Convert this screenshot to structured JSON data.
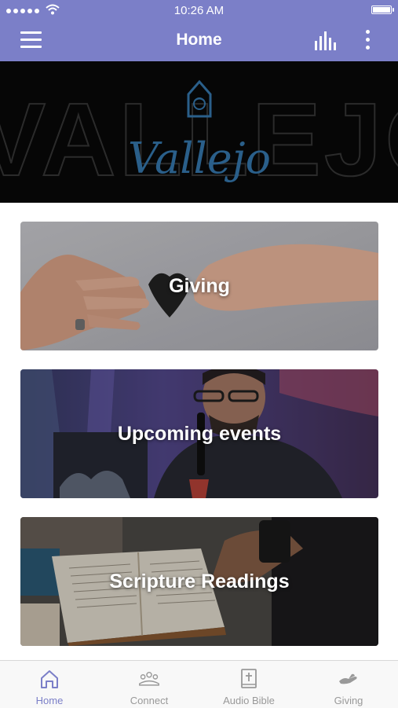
{
  "status_bar": {
    "time": "10:26 AM"
  },
  "header": {
    "title": "Home"
  },
  "banner": {
    "watermark": "VALLEJO",
    "logo_text": "Vallejo"
  },
  "cards": [
    {
      "title": "Giving"
    },
    {
      "title": "Upcoming events"
    },
    {
      "title": "Scripture Readings"
    }
  ],
  "tabs": [
    {
      "label": "Home",
      "icon": "home-icon",
      "active": true
    },
    {
      "label": "Connect",
      "icon": "people-icon",
      "active": false
    },
    {
      "label": "Audio Bible",
      "icon": "bible-icon",
      "active": false
    },
    {
      "label": "Giving",
      "icon": "giving-hand-icon",
      "active": false
    }
  ],
  "colors": {
    "accent": "#7b7fc8",
    "tab_inactive": "#999999",
    "banner_bg": "#060606",
    "logo": "#2a5f8a"
  }
}
